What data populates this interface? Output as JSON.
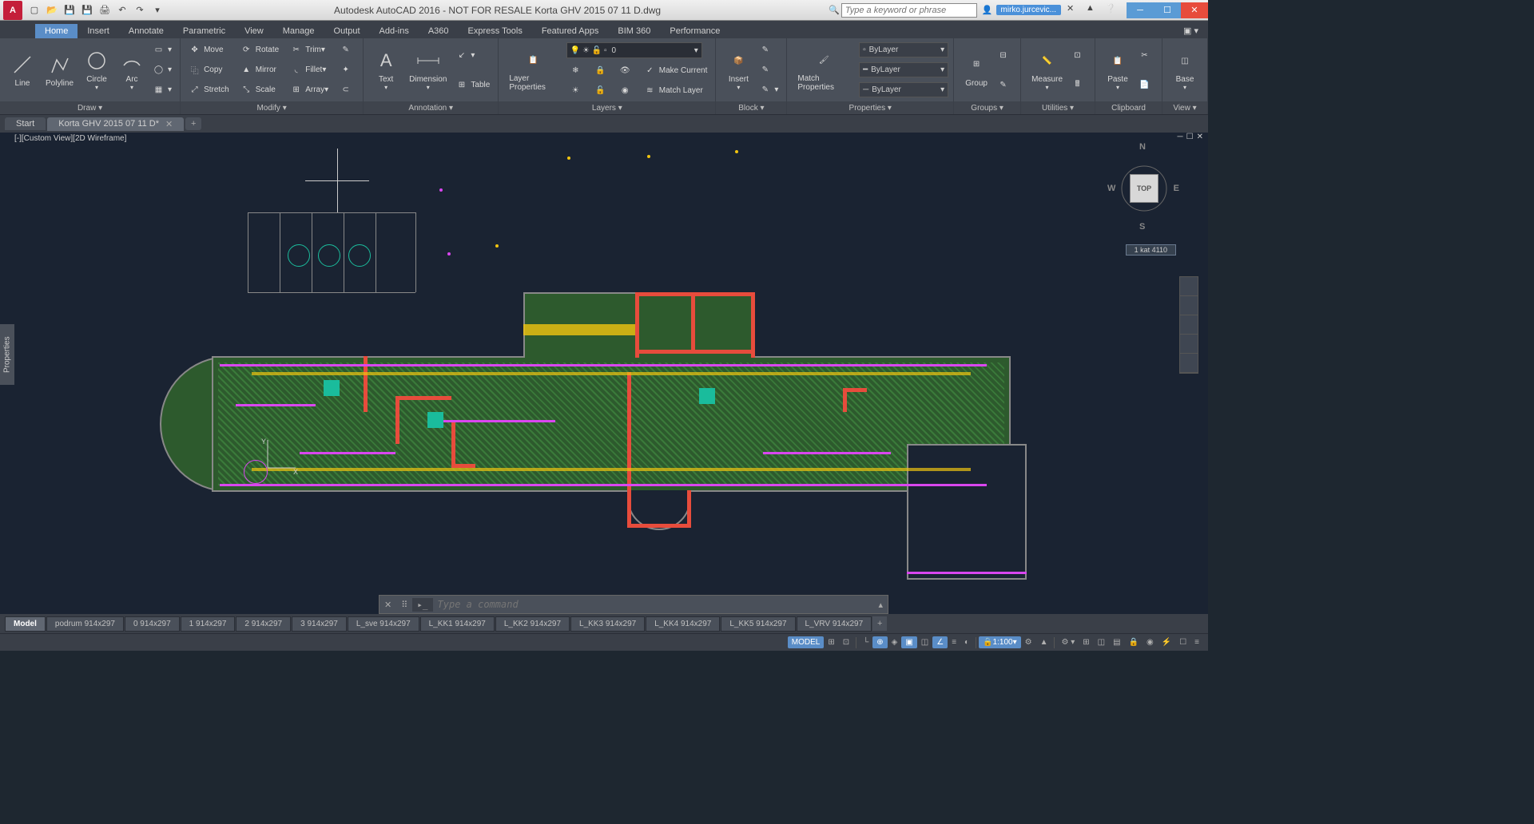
{
  "qat": {
    "title": "Autodesk AutoCAD 2016 - NOT FOR RESALE    Korta GHV 2015 07 11 D.dwg",
    "search_placeholder": "Type a keyword or phrase",
    "user": "mirko.jurcevic..."
  },
  "ribbon_tabs": [
    "Home",
    "Insert",
    "Annotate",
    "Parametric",
    "View",
    "Manage",
    "Output",
    "Add-ins",
    "A360",
    "Express Tools",
    "Featured Apps",
    "BIM 360",
    "Performance"
  ],
  "ribbon_active": 0,
  "panels": {
    "draw": {
      "title": "Draw ▾",
      "btns": [
        "Line",
        "Polyline",
        "Circle",
        "Arc"
      ]
    },
    "modify": {
      "title": "Modify ▾",
      "items": [
        "Move",
        "Copy",
        "Stretch",
        "Rotate",
        "Mirror",
        "Scale",
        "Trim",
        "Fillet",
        "Array"
      ]
    },
    "annotation": {
      "title": "Annotation ▾",
      "btns": [
        "Text",
        "Dimension",
        "Table"
      ]
    },
    "layers": {
      "title": "Layers ▾",
      "btn": "Layer Properties",
      "combo": "0",
      "items": [
        "Make Current",
        "Match Layer"
      ]
    },
    "block": {
      "title": "Block ▾",
      "btn": "Insert"
    },
    "properties": {
      "title": "Properties ▾",
      "btn": "Match Properties",
      "combos": [
        "ByLayer",
        "ByLayer",
        "ByLayer"
      ]
    },
    "groups": {
      "title": "Groups ▾",
      "btn": "Group"
    },
    "utilities": {
      "title": "Utilities ▾",
      "btn": "Measure"
    },
    "clipboard": {
      "title": "Clipboard",
      "btn": "Paste"
    },
    "view": {
      "title": "View ▾",
      "btn": "Base"
    }
  },
  "file_tabs": [
    {
      "label": "Start",
      "active": false
    },
    {
      "label": "Korta GHV 2015 07 11 D*",
      "active": true
    }
  ],
  "view_label": "[-][Custom View][2D Wireframe]",
  "properties_panel": "Properties",
  "viewcube": {
    "top": "TOP",
    "n": "N",
    "e": "E",
    "s": "S",
    "w": "W"
  },
  "coord_hint": "1 kat 4110",
  "ucs": {
    "x": "X",
    "y": "Y"
  },
  "cmd": {
    "placeholder": "Type a command"
  },
  "layout_tabs": [
    "Model",
    "podrum 914x297",
    "0 914x297",
    "1 914x297",
    "2 914x297",
    "3 914x297",
    "L_sve 914x297",
    "L_KK1 914x297",
    "L_KK2 914x297",
    "L_KK3 914x297",
    "L_KK4 914x297",
    "L_KK5 914x297",
    "L_VRV 914x297"
  ],
  "layout_active": 0,
  "status": {
    "model": "MODEL",
    "scale": "1:100"
  }
}
